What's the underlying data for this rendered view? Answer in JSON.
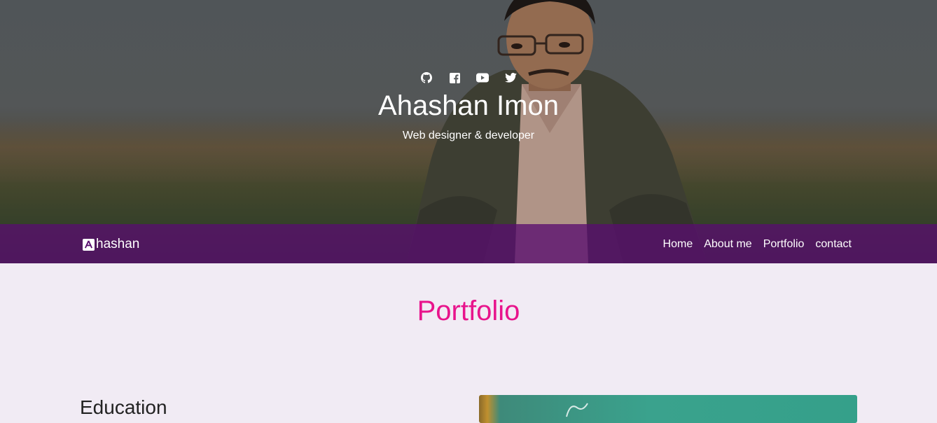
{
  "hero": {
    "name": "Ahashan Imon",
    "tagline": "Web designer & developer",
    "social_icons": [
      "github-icon",
      "facebook-icon",
      "youtube-icon",
      "twitter-icon"
    ]
  },
  "navbar": {
    "brand_text": "hashan",
    "brand_icon": "app-store-logo-icon",
    "links": [
      "Home",
      "About me",
      "Portfolio",
      "contact"
    ]
  },
  "portfolio": {
    "title": "Portfolio",
    "education_heading": "Education"
  },
  "colors": {
    "navbar_bg": "#580e6e",
    "accent": "#e8148c",
    "page_bg": "#f1ebf4"
  }
}
